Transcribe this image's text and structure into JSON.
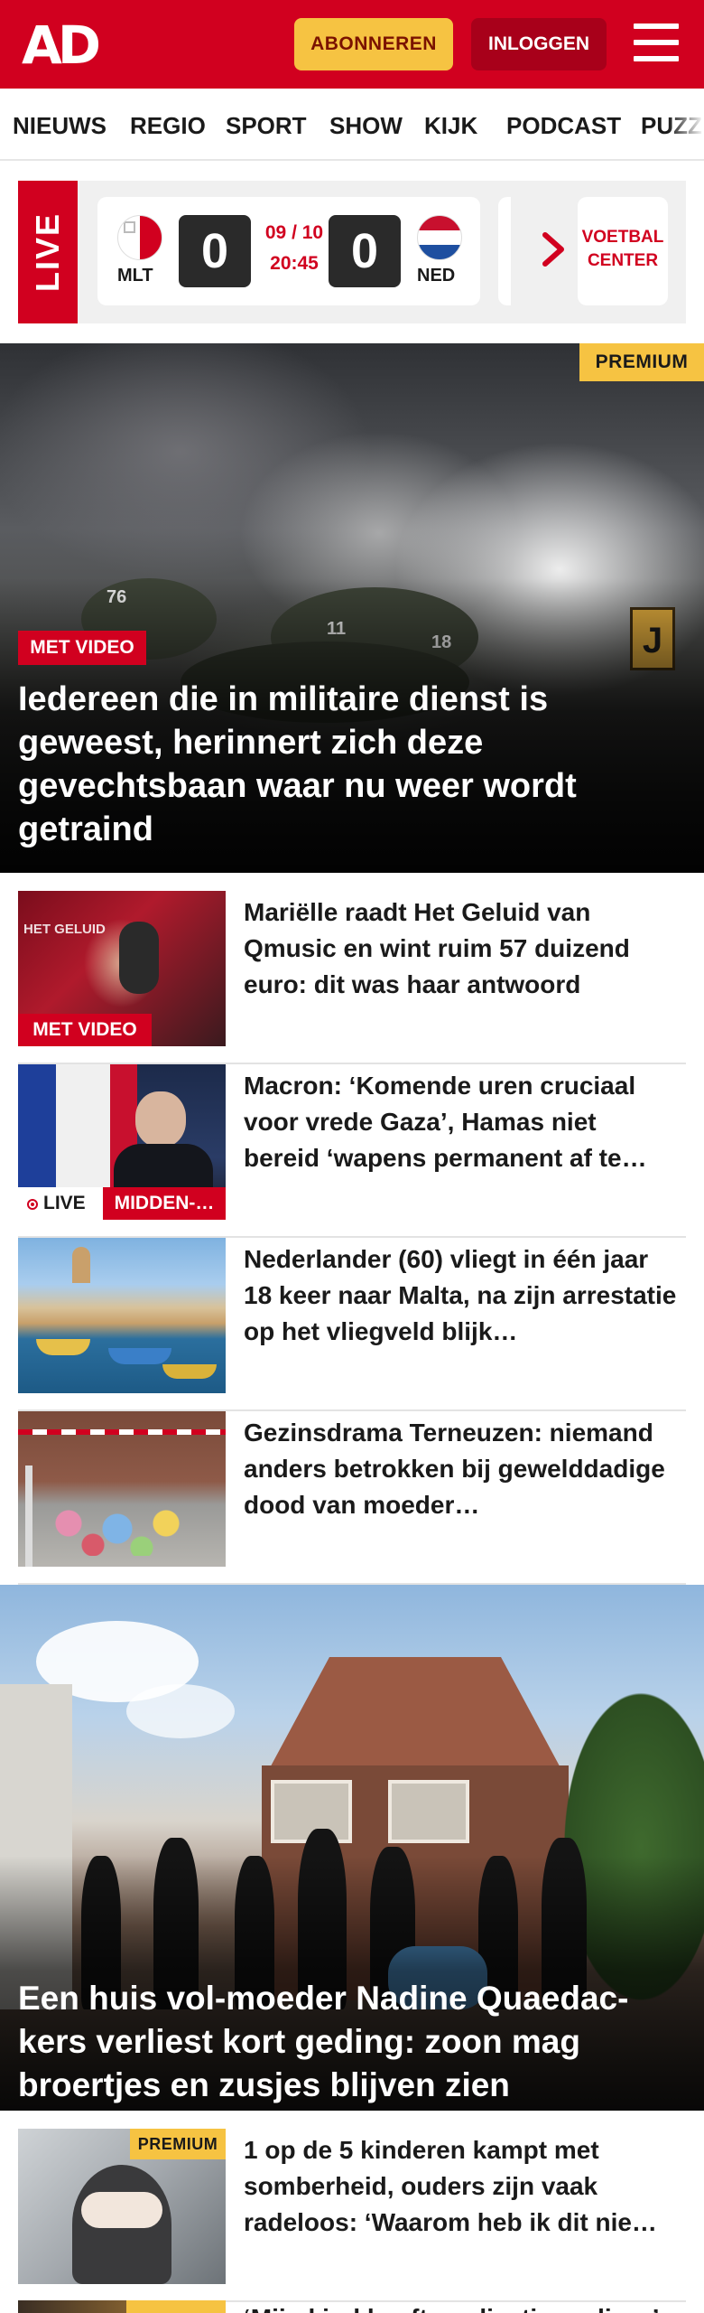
{
  "header": {
    "logo": "AD",
    "subscribe_label": "ABONNEREN",
    "login_label": "INLOGGEN",
    "brand_color": "#d1001f",
    "accent_color": "#f6c342"
  },
  "nav": {
    "items": [
      {
        "label": "NIEUWS"
      },
      {
        "label": "REGIO"
      },
      {
        "label": "SPORT"
      },
      {
        "label": "SHOW"
      },
      {
        "label": "KIJK"
      },
      {
        "label": "PODCAST"
      },
      {
        "label": "PUZZ"
      }
    ]
  },
  "live": {
    "label": "LIVE",
    "match": {
      "home_code": "MLT",
      "home_score": "0",
      "away_code": "NED",
      "away_score": "0",
      "date": "09 / 10",
      "time": "20:45"
    },
    "voetbal_center": "VOETBAL CENTER"
  },
  "hero1": {
    "premium_label": "PREMIUM",
    "video_label": "MET VIDEO",
    "title": "Iedereen die in militaire dienst is geweest, herinnert zich deze gevechtsbaan waar nu weer wordt getraind",
    "image_detail": {
      "helmets": [
        "76",
        "11",
        "18"
      ],
      "sign": "J"
    }
  },
  "articles": [
    {
      "title": "Mariëlle raadt Het Geluid van Qmusic en wint ruim 57 duizend euro: dit was haar antwoord",
      "tag": "MET VIDEO",
      "thumb_text": "HET GELUID"
    },
    {
      "title": "Macron: ‘Komende uren cruciaal voor vrede Gaza’, Hamas niet bereid ‘wapens permanent af te…",
      "live_label": "LIVE",
      "section_tag": "MIDDEN-…"
    },
    {
      "title": "Nederlander (60) vliegt in één jaar 18 keer naar Malta, na zijn arrestatie op het vliegveld blijk…"
    },
    {
      "title": "Gezinsdrama Terneuzen: niemand anders betrokken bij gewelddadige dood van moeder…"
    }
  ],
  "hero2": {
    "title": "Een huis vol-moeder Nadine Quaedac-kers verliest kort geding: zoon mag broertjes en zusjes blijven zien"
  },
  "premium_articles": [
    {
      "premium_label": "PREMIUM",
      "title": "1 op de 5 kinderen kampt met somberheid, ouders zijn vaak radeloos: ‘Waarom heb ik dit nie…"
    },
    {
      "premium_label": "PREMIUM",
      "title": "‘Mijn kind heeft medicatie nodig…’"
    }
  ]
}
